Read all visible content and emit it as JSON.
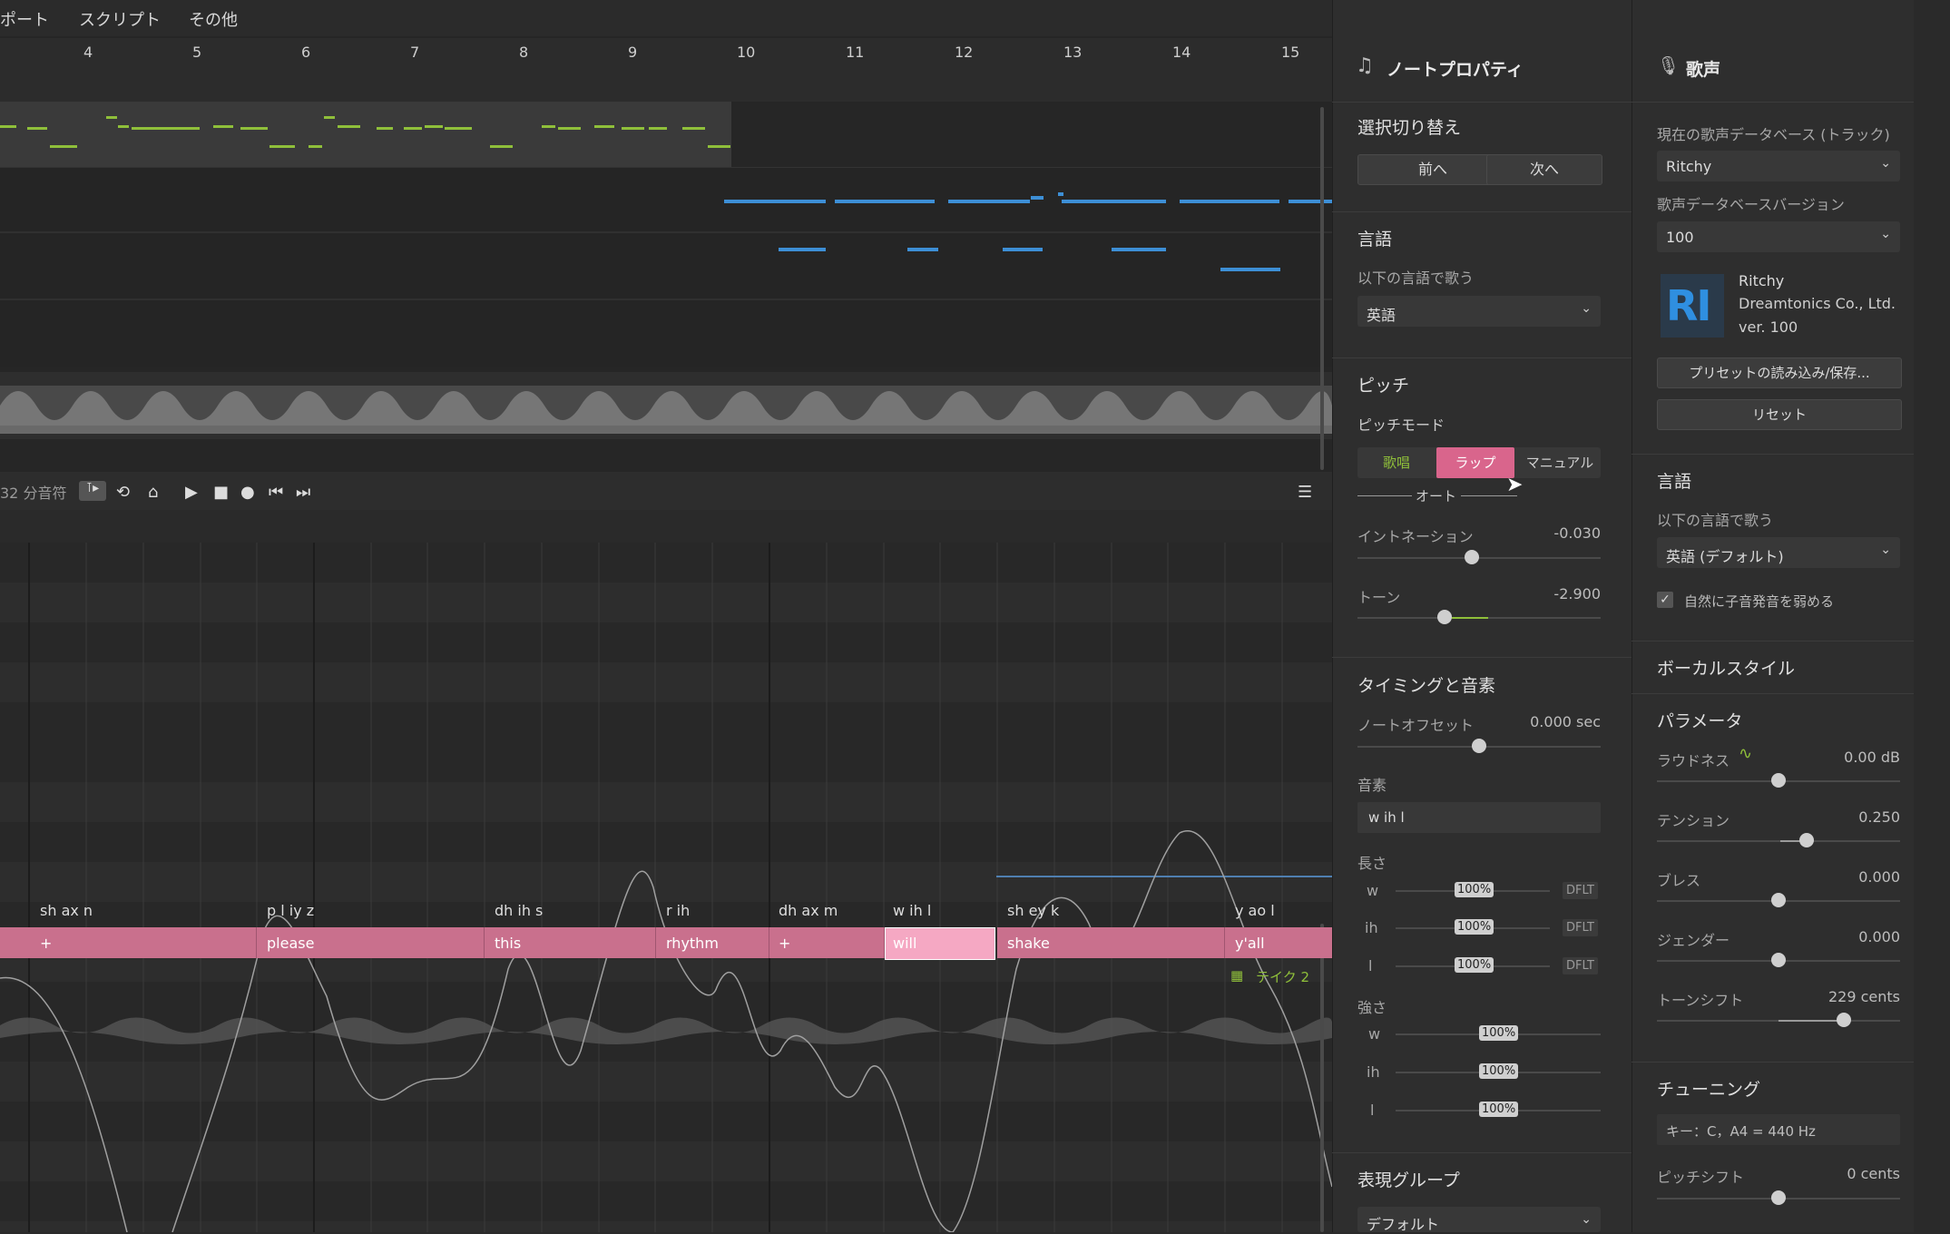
{
  "menu": [
    "ポート",
    "スクリプト",
    "その他"
  ],
  "ruler": {
    "bars": [
      "4",
      "5",
      "6",
      "7",
      "8",
      "9",
      "10",
      "11",
      "12",
      "13",
      "14",
      "15"
    ]
  },
  "transport": {
    "quantize": "32 分音符"
  },
  "phonemes": [
    "sh ax n",
    "p l iy z",
    "dh ih s",
    "r ih",
    "dh ax m",
    "w ih l",
    "sh ey k",
    "y ao l"
  ],
  "lyrics": [
    "+",
    "please",
    "this",
    "rhythm",
    "+",
    "will",
    "shake",
    "y'all"
  ],
  "take_label": "テイク 2",
  "note_panel": {
    "title": "ノートプロパティ",
    "selection": {
      "heading": "選択切り替え",
      "prev": "前へ",
      "next": "次へ"
    },
    "language": {
      "heading": "言語",
      "label": "以下の言語で歌う",
      "value": "英語"
    },
    "pitch": {
      "heading": "ピッチ",
      "mode_label": "ピッチモード",
      "modes": [
        "歌唱",
        "ラップ",
        "マニュアル"
      ],
      "active_mode": "ラップ",
      "auto": "オート",
      "intonation": {
        "label": "イントネーション",
        "value": "-0.030"
      },
      "tone": {
        "label": "トーン",
        "value": "-2.900"
      }
    },
    "timing": {
      "heading": "タイミングと音素",
      "offset": {
        "label": "ノートオフセット",
        "value": "0.000 sec"
      },
      "phoneme_label": "音素",
      "phoneme_value": "w ih l",
      "length_label": "長さ",
      "lengths": [
        {
          "ph": "w",
          "pct": "100%",
          "tag": "DFLT"
        },
        {
          "ph": "ih",
          "pct": "100%",
          "tag": "DFLT"
        },
        {
          "ph": "l",
          "pct": "100%",
          "tag": "DFLT"
        }
      ],
      "strength_label": "強さ",
      "strengths": [
        {
          "ph": "w",
          "pct": "100%"
        },
        {
          "ph": "ih",
          "pct": "100%"
        },
        {
          "ph": "l",
          "pct": "100%"
        }
      ]
    },
    "expression": {
      "heading": "表現グループ",
      "value": "デフォルト"
    }
  },
  "voice_panel": {
    "title": "歌声",
    "db_label": "現在の歌声データベース (トラック)",
    "db_value": "Ritchy",
    "ver_label": "歌声データベースバージョン",
    "ver_value": "100",
    "voice": {
      "name": "Ritchy",
      "company": "Dreamtonics Co., Ltd.",
      "version": "ver. 100",
      "logo": "RI"
    },
    "preset_button": "プリセットの読み込み/保存...",
    "reset_button": "リセット",
    "language": {
      "heading": "言語",
      "label": "以下の言語で歌う",
      "value": "英語 (デフォルト)",
      "checkbox": "自然に子音発音を弱める"
    },
    "vocal_style": "ボーカルスタイル",
    "params_heading": "パラメータ",
    "params": [
      {
        "label": "ラウドネス",
        "value": "0.00 dB",
        "level": 0.5
      },
      {
        "label": "テンション",
        "value": "0.250",
        "level": 0.625
      },
      {
        "label": "ブレス",
        "value": "0.000",
        "level": 0.5
      },
      {
        "label": "ジェンダー",
        "value": "0.000",
        "level": 0.5
      },
      {
        "label": "トーンシフト",
        "value": "229 cents",
        "level": 0.76
      }
    ],
    "tuning": {
      "heading": "チューニング",
      "key": "キー：C，A4 = 440 Hz",
      "pitch_shift_label": "ピッチシフト",
      "pitch_shift_value": "0 cents"
    }
  },
  "colors": {
    "note": "#c9708d",
    "selected_note": "#f5a8c3",
    "green_note": "#8fbf3a",
    "blue_note": "#3d8fd6",
    "rap_mode": "#d9658c"
  }
}
